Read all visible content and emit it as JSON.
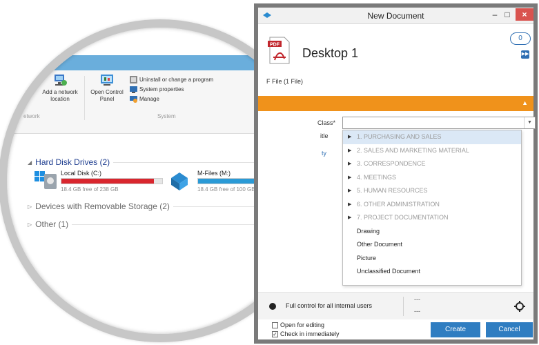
{
  "explorer": {
    "ribbon": {
      "add_network_location": "Add a network location",
      "map_prefix": "rk",
      "open_control_panel": "Open Control Panel",
      "uninstall": "Uninstall or change a program",
      "system_properties": "System properties",
      "manage": "Manage",
      "group_network": "etwork",
      "group_system": "System"
    },
    "sections": {
      "hard_disk_drives": "Hard Disk Drives (2)",
      "removable": "Devices with Removable Storage (2)",
      "other": "Other (1)"
    },
    "drives": [
      {
        "name": "Local Disk (C:)",
        "free": "18.4 GB free of 238 GB",
        "used_fraction": 0.92,
        "color": "#d9262e"
      },
      {
        "name": "M-Files (M:)",
        "free": "18.4 GB free of 100 GB",
        "used_fraction": 0.82,
        "color": "#2a9ad6"
      }
    ]
  },
  "dialog": {
    "title": "New Document",
    "document_name": "Desktop 1",
    "file_info": "F File (1 File)",
    "comment_count": "0",
    "class_label": "Class*",
    "title_label": "itle",
    "third_label": "ty",
    "class_value": "",
    "class_options": [
      {
        "label": "1. PURCHASING AND SALES",
        "group": true
      },
      {
        "label": "2. SALES AND MARKETING MATERIAL",
        "group": true
      },
      {
        "label": "3. CORRESPONDENCE",
        "group": true
      },
      {
        "label": "4. MEETINGS",
        "group": true
      },
      {
        "label": "5. HUMAN RESOURCES",
        "group": true
      },
      {
        "label": "6. OTHER ADMINISTRATION",
        "group": true
      },
      {
        "label": "7. PROJECT DOCUMENTATION",
        "group": true
      },
      {
        "label": "Drawing",
        "group": false
      },
      {
        "label": "Other Document",
        "group": false
      },
      {
        "label": "Picture",
        "group": false
      },
      {
        "label": "Unclassified Document",
        "group": false
      }
    ],
    "permissions": "Full control for all internal users",
    "perm_dash_1": "---",
    "perm_dash_2": "---",
    "open_for_editing": "Open for editing",
    "open_for_editing_checked": false,
    "check_in_immediately": "Check in immediately",
    "check_in_immediately_checked": true,
    "create_label": "Create",
    "cancel_label": "Cancel"
  },
  "colors": {
    "accent": "#2f7dc1",
    "orange": "#f0921b",
    "close": "#d9534f"
  }
}
